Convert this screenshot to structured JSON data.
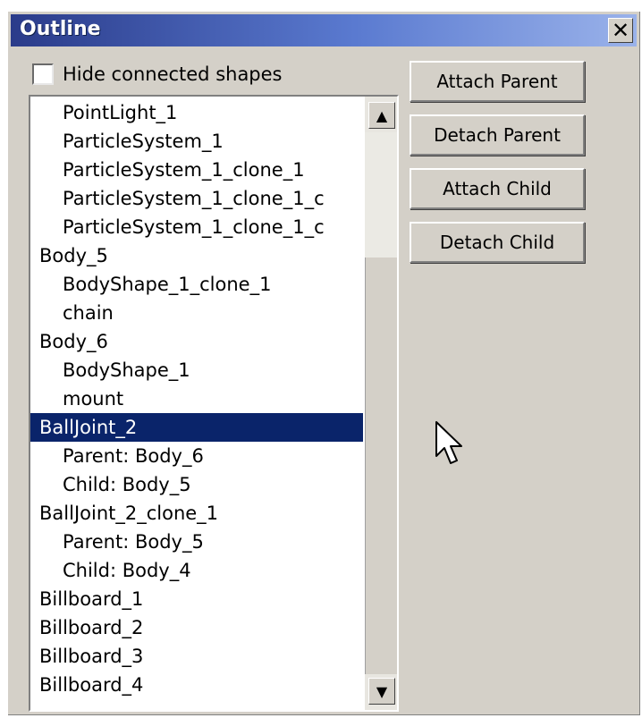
{
  "window": {
    "title": "Outline",
    "close_label": "✕"
  },
  "hide_connected": {
    "label": "Hide connected shapes",
    "checked": false
  },
  "buttons": {
    "attach_parent": "Attach Parent",
    "detach_parent": "Detach Parent",
    "attach_child": "Attach Child",
    "detach_child": "Detach Child"
  },
  "scrollbar": {
    "up_icon": "▲",
    "down_icon": "▼"
  },
  "list": {
    "items": [
      {
        "label": "PointLight_1",
        "indent": true,
        "selected": false
      },
      {
        "label": "ParticleSystem_1",
        "indent": true,
        "selected": false
      },
      {
        "label": "ParticleSystem_1_clone_1",
        "indent": true,
        "selected": false
      },
      {
        "label": "ParticleSystem_1_clone_1_c",
        "indent": true,
        "selected": false
      },
      {
        "label": "ParticleSystem_1_clone_1_c",
        "indent": true,
        "selected": false
      },
      {
        "label": "Body_5",
        "indent": false,
        "selected": false
      },
      {
        "label": "BodyShape_1_clone_1",
        "indent": true,
        "selected": false
      },
      {
        "label": "chain",
        "indent": true,
        "selected": false
      },
      {
        "label": "Body_6",
        "indent": false,
        "selected": false
      },
      {
        "label": "BodyShape_1",
        "indent": true,
        "selected": false
      },
      {
        "label": "mount",
        "indent": true,
        "selected": false
      },
      {
        "label": "BallJoint_2",
        "indent": false,
        "selected": true
      },
      {
        "label": "Parent: Body_6",
        "indent": true,
        "selected": false
      },
      {
        "label": "Child: Body_5",
        "indent": true,
        "selected": false
      },
      {
        "label": "BallJoint_2_clone_1",
        "indent": false,
        "selected": false
      },
      {
        "label": "Parent: Body_5",
        "indent": true,
        "selected": false
      },
      {
        "label": "Child: Body_4",
        "indent": true,
        "selected": false
      },
      {
        "label": "Billboard_1",
        "indent": false,
        "selected": false
      },
      {
        "label": "Billboard_2",
        "indent": false,
        "selected": false
      },
      {
        "label": "Billboard_3",
        "indent": false,
        "selected": false
      },
      {
        "label": "Billboard_4",
        "indent": false,
        "selected": false
      }
    ]
  }
}
